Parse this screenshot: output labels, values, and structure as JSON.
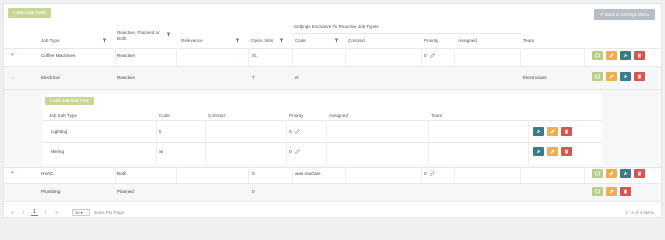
{
  "toolbar": {
    "add_job_type": "+ ADD JOB TYPE",
    "back": "↶ Back to Settings Menu"
  },
  "header": {
    "group_label": "Settings Exclusive To Reactive Job Types",
    "columns": {
      "job_type": "Job Type",
      "reactive_planned": [
        "Reactive, Planned or",
        "Both"
      ],
      "relevance": "Relevance",
      "open_jobs": "Open Jobs",
      "code": "Code",
      "contract": "Contract",
      "priority": "Priority",
      "assigned": "Assigned",
      "team": "Team"
    }
  },
  "rows": [
    {
      "expander": "+",
      "job_type": "Coffee Machines",
      "mode": "Reactive",
      "relevance": "",
      "open_jobs": "81",
      "code": "",
      "contract": "",
      "priority": "0",
      "assigned": "",
      "team": ""
    },
    {
      "expander": "-",
      "job_type": "Electrical",
      "mode": "Reactive",
      "relevance": "",
      "open_jobs": "7",
      "code": "el",
      "contract": "",
      "priority": "",
      "assigned": "",
      "team": "Electricians"
    },
    {
      "expander": "+",
      "job_type": "HVAC",
      "mode": "Both",
      "relevance": "",
      "open_jobs": "0",
      "code": "was reactive",
      "contract": "",
      "priority": "0",
      "assigned": "",
      "team": ""
    },
    {
      "expander": "",
      "job_type": "Plumbing",
      "mode": "Planned",
      "relevance": "",
      "open_jobs": "0",
      "code": "",
      "contract": "",
      "priority": "",
      "assigned": "",
      "team": ""
    }
  ],
  "subtable": {
    "add_label": "+ ADD JOB SUB TYPE",
    "columns": {
      "name": "Job Sub Type",
      "code": "Code",
      "contract": "Contract",
      "priority": "Priority",
      "assigned": "Assigned",
      "team": "Team"
    },
    "rows": [
      {
        "name": "Lighting",
        "code": "li",
        "contract": "",
        "priority": "0",
        "assigned": "",
        "team": ""
      },
      {
        "name": "Wiring",
        "code": "wi",
        "contract": "",
        "priority": "0",
        "assigned": "",
        "team": ""
      }
    ]
  },
  "pager": {
    "first": "«",
    "prev": "‹",
    "current": "1",
    "next": "›",
    "last": "»",
    "page_size": "10",
    "page_size_label": "items Per Page",
    "summary": "1 - 4 of 4 items"
  },
  "colors": {
    "add": "#c9d69a",
    "view": "#b8cf86",
    "edit": "#f0ad4e",
    "link": "#3b7c8a",
    "delete": "#d9534f"
  }
}
